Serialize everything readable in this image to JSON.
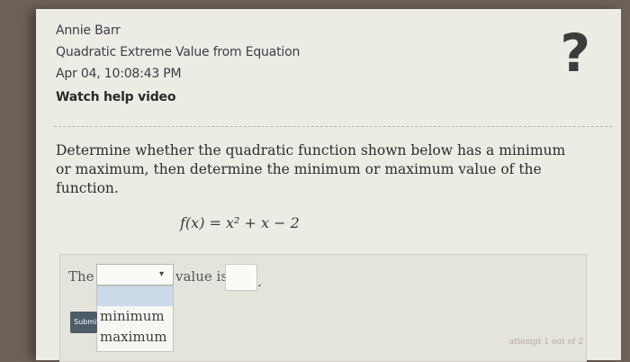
{
  "header": {
    "student_name": "Annie Barr",
    "assignment_title": "Quadratic Extreme Value from Equation",
    "timestamp": "Apr 04, 10:08:43 PM",
    "help_link": "Watch help video",
    "help_icon": "question-mark-icon",
    "help_icon_glyph": "?"
  },
  "question": {
    "text": "Determine whether the quadratic function shown below has a minimum or maximum, then determine the minimum or maximum value of the function.",
    "formula": "f(x) = x² + x − 2"
  },
  "answer": {
    "prefix": "The",
    "select_value": "",
    "select_options": [
      "",
      "minimum",
      "maximum"
    ],
    "middle_text": "value is",
    "value_input": "",
    "suffix": "."
  },
  "submit_label": "Submit",
  "attempt_text": "attempt 1 out of 2"
}
